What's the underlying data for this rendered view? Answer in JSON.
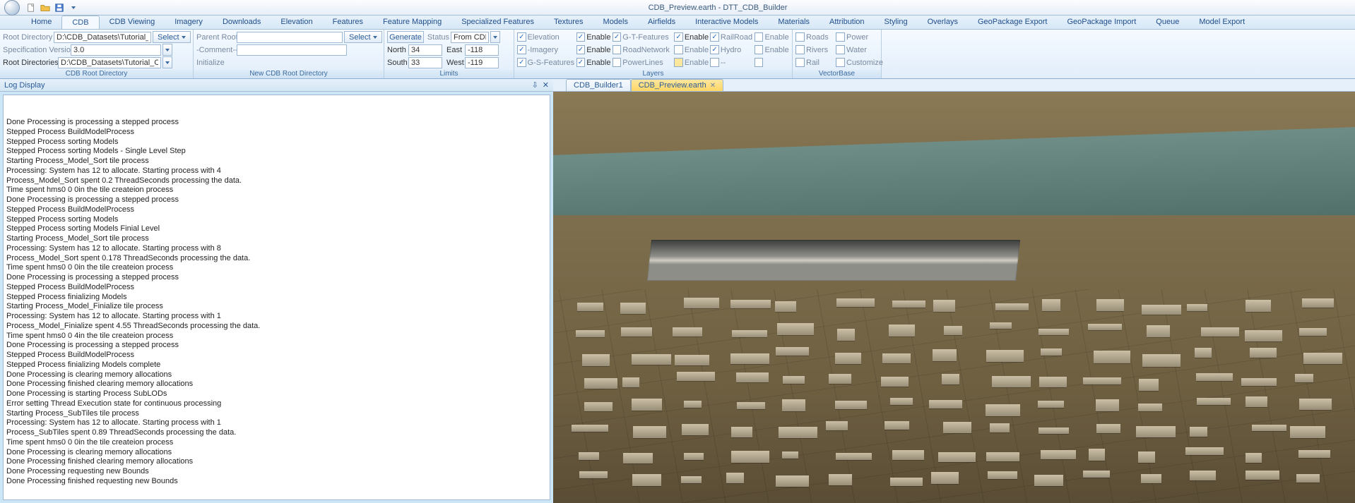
{
  "title": "CDB_Preview.earth - DTT_CDB_Builder",
  "qat": [
    "new-icon",
    "open-icon",
    "save-icon",
    "dropdown-icon"
  ],
  "tabs": [
    "Home",
    "CDB",
    "CDB Viewing",
    "Imagery",
    "Downloads",
    "Elevation",
    "Features",
    "Feature Mapping",
    "Specialized Features",
    "Textures",
    "Models",
    "Airfields",
    "Interactive Models",
    "Materials",
    "Attribution",
    "Styling",
    "Overlays",
    "GeoPackage Export",
    "GeoPackage Import",
    "Queue",
    "Model Export"
  ],
  "active_tab": 1,
  "groups": {
    "rootdir": {
      "label": "CDB Root Directory",
      "root_directory_lbl": "Root Directory",
      "root_directory_val": "D:\\CDB_Datasets\\Tutorial_CDB",
      "select": "Select",
      "spec_lbl": "Specification Version",
      "spec_val": "3.0",
      "rootdirs_lbl": "Root Directories",
      "rootdirs_val": "D:\\CDB_Datasets\\Tutorial_CDB\\"
    },
    "newroot": {
      "label": "New CDB Root Directory",
      "parent_lbl": "Parent Root",
      "select": "Select",
      "comment_ph": "-Comment--",
      "initialize": "Initialize"
    },
    "limits": {
      "label": "Limits",
      "generate": "Generate",
      "status_lbl": "Status",
      "status_val": "From CDB",
      "north_lbl": "North",
      "north_val": "34",
      "east_lbl": "East",
      "east_val": "-118",
      "south_lbl": "South",
      "south_val": "33",
      "west_lbl": "West",
      "west_val": "-119"
    },
    "layers": {
      "label": "Layers",
      "rows": [
        {
          "a": "Elevation",
          "ae": "Enable",
          "b": "G-T-Features",
          "be": "Enable",
          "c": "RailRoad",
          "ce": "Enable"
        },
        {
          "a": "-Imagery",
          "ae": "Enable",
          "b": "RoadNetwork",
          "be": "Enable",
          "c": "Hydro",
          "ce": "Enable"
        },
        {
          "a": "G-S-Features",
          "ae": "Enable",
          "b": "PowerLines",
          "be": "Enable",
          "c": "--",
          "ce": ""
        }
      ]
    },
    "vbase": {
      "label": "VectorBase",
      "rows": [
        {
          "a": "Roads",
          "b": "Power"
        },
        {
          "a": "Rivers",
          "b": "Water"
        },
        {
          "a": "Rail",
          "b": "Customize"
        }
      ]
    }
  },
  "panel_title": "Log Display",
  "panel_pin": "⇩",
  "panel_close": "✕",
  "doc_tabs": [
    {
      "name": "CDB_Builder1",
      "active": false
    },
    {
      "name": "CDB_Preview.earth",
      "active": true
    }
  ],
  "log": "Done Processing is processing a stepped process\nStepped Process BuildModelProcess\nStepped Process sorting Models\nStepped Process sorting Models - Single Level Step\nStarting Process_Model_Sort tile process\nProcessing: System has 12 to allocate. Starting process with 4\nProcess_Model_Sort spent 0.2 ThreadSeconds processing the data.\nTime spent hms0 0 0in the tile createion process\nDone Processing is processing a stepped process\nStepped Process BuildModelProcess\nStepped Process sorting Models\nStepped Process sorting Models Finial Level\nStarting Process_Model_Sort tile process\nProcessing: System has 12 to allocate. Starting process with 8\nProcess_Model_Sort spent 0.178 ThreadSeconds processing the data.\nTime spent hms0 0 0in the tile createion process\nDone Processing is processing a stepped process\nStepped Process BuildModelProcess\nStepped Process finializing Models\nStarting Process_Model_Finialize tile process\nProcessing: System has 12 to allocate. Starting process with 1\nProcess_Model_Finialize spent 4.55 ThreadSeconds processing the data.\nTime spent hms0 0 4in the tile createion process\nDone Processing is processing a stepped process\nStepped Process BuildModelProcess\nStepped Process finializing Models complete\nDone Processing is clearing memory allocations\nDone Processing finished clearing memory allocations\nDone Processing is starting Process SubLODs\nError setting Thread Execution state for continuous processing\nStarting Process_SubTiles tile process\nProcessing: System has 12 to allocate. Starting process with 1\nProcess_SubTiles spent 0.89 ThreadSeconds processing the data.\nTime spent hms0 0 0in the tile createion process\nDone Processing is clearing memory allocations\nDone Processing finished clearing memory allocations\nDone Processing requesting new Bounds\nDone Processing finished requesting new Bounds"
}
